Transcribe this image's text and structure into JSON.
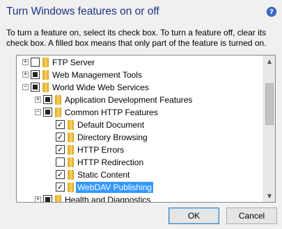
{
  "dialog": {
    "title": "Turn Windows features on or off",
    "help_icon": "?",
    "description": "To turn a feature on, select its check box. To turn a feature off, clear its check box. A filled box means that only part of the feature is turned on."
  },
  "tree": {
    "items": [
      {
        "label": "FTP Server",
        "level": 0,
        "expander": "+",
        "state": "unchecked",
        "selected": false
      },
      {
        "label": "Web Management Tools",
        "level": 0,
        "expander": "+",
        "state": "partial",
        "selected": false
      },
      {
        "label": "World Wide Web Services",
        "level": 0,
        "expander": "-",
        "state": "partial",
        "selected": false
      },
      {
        "label": "Application Development Features",
        "level": 1,
        "expander": "+",
        "state": "partial",
        "selected": false
      },
      {
        "label": "Common HTTP Features",
        "level": 1,
        "expander": "-",
        "state": "partial",
        "selected": false
      },
      {
        "label": "Default Document",
        "level": 2,
        "expander": "",
        "state": "checked",
        "selected": false
      },
      {
        "label": "Directory Browsing",
        "level": 2,
        "expander": "",
        "state": "checked",
        "selected": false
      },
      {
        "label": "HTTP Errors",
        "level": 2,
        "expander": "",
        "state": "checked",
        "selected": false
      },
      {
        "label": "HTTP Redirection",
        "level": 2,
        "expander": "",
        "state": "unchecked",
        "selected": false
      },
      {
        "label": "Static Content",
        "level": 2,
        "expander": "",
        "state": "checked",
        "selected": false
      },
      {
        "label": "WebDAV Publishing",
        "level": 2,
        "expander": "",
        "state": "checked",
        "selected": true
      },
      {
        "label": "Health and Diagnostics",
        "level": 1,
        "expander": "+",
        "state": "partial",
        "selected": false
      }
    ]
  },
  "buttons": {
    "ok": "OK",
    "cancel": "Cancel"
  },
  "colors": {
    "title": "#1e3287",
    "selection": "#3399ff"
  }
}
